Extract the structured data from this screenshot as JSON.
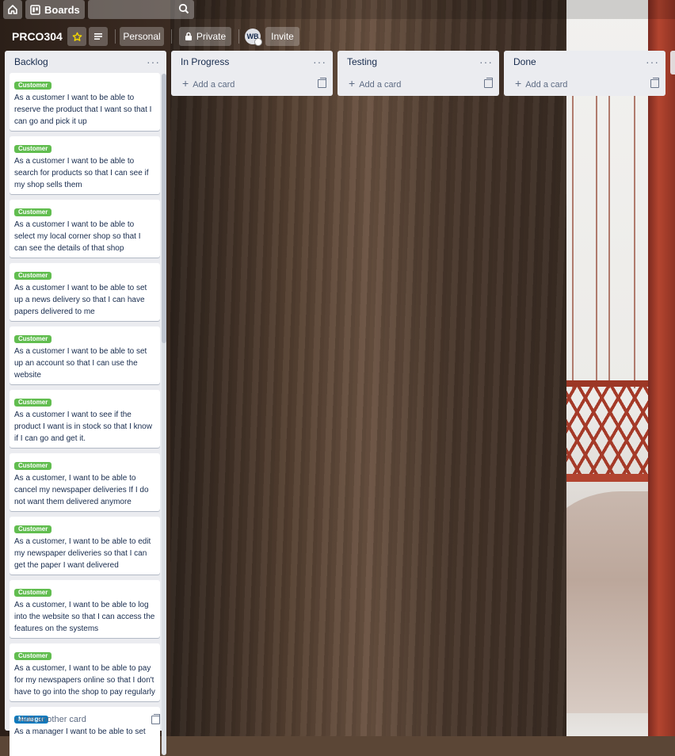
{
  "topbar": {
    "boards_label": "Boards",
    "search_value": ""
  },
  "board": {
    "title": "PRCO304",
    "personal_label": "Personal",
    "private_label": "Private",
    "avatar_initials": "WB",
    "invite_label": "Invite",
    "star_color": "#f2d600"
  },
  "lists": [
    {
      "title": "Backlog",
      "add_label": "Add another card"
    },
    {
      "title": "In Progress",
      "add_label": "Add a card"
    },
    {
      "title": "Testing",
      "add_label": "Add a card"
    },
    {
      "title": "Done",
      "add_label": "Add a card"
    }
  ],
  "backlog_cards": [
    {
      "label": "Customer",
      "text": "As a customer I want to be able to reserve the product that I want so that I can go and pick it up"
    },
    {
      "label": "Customer",
      "text": "As a customer I want to be able to search for products so that I can see if my shop sells them"
    },
    {
      "label": "Customer",
      "text": "As a customer I want to be able to select my local corner shop so that I can see the details of that shop"
    },
    {
      "label": "Customer",
      "text": "As a customer I want to be able to set up a news delivery so that I can have papers delivered to me"
    },
    {
      "label": "Customer",
      "text": "As a customer I want to be able to set up an account so that I can use the website"
    },
    {
      "label": "Customer",
      "text": "As a customer I want to see if the product I want is in stock so that I know if I can go and get it."
    },
    {
      "label": "Customer",
      "text": "As a customer, I want to be able to cancel my newspaper deliveries If I do not want them delivered anymore"
    },
    {
      "label": "Customer",
      "text": "As a customer, I want to be able to edit my newspaper deliveries so that I can get the paper I want delivered"
    },
    {
      "label": "Customer",
      "text": "As a customer, I want to be able to log into the website so that I can access the features on the systems"
    },
    {
      "label": "Customer",
      "text": "As a customer, I want to be able to pay for my newspapers online so that I don't have to go into the shop to pay regularly"
    },
    {
      "label": "Manager",
      "text": "As a manager I want to be able to set"
    }
  ],
  "colors": {
    "customer_label": "#61bd4f",
    "manager_label": "#0079bf"
  }
}
